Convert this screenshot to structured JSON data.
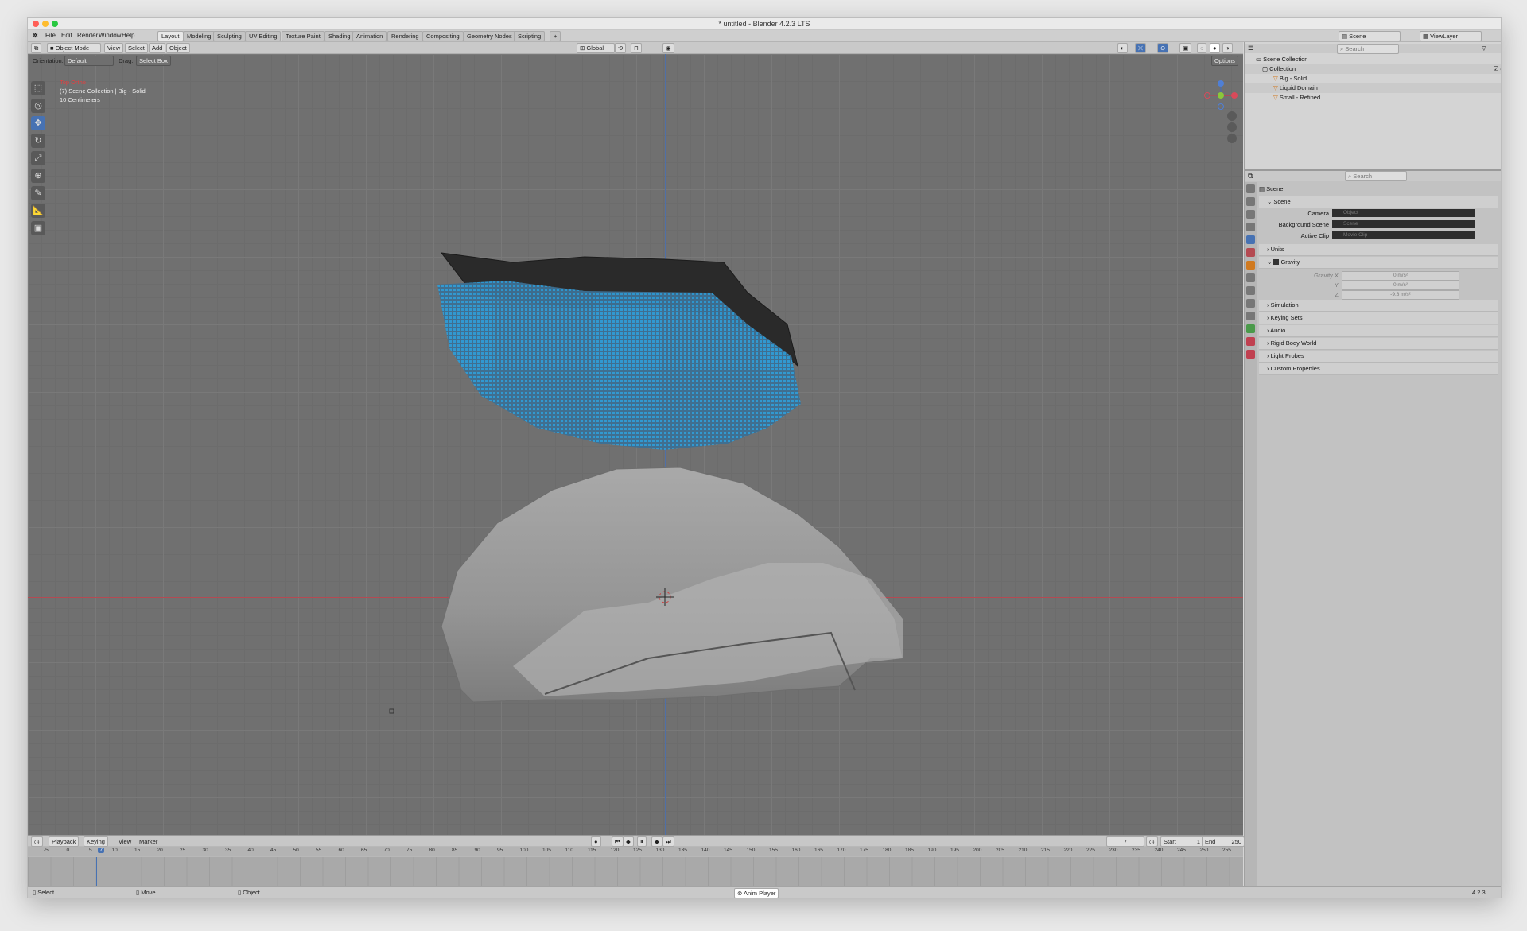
{
  "window": {
    "title": "* untitled - Blender 4.2.3 LTS"
  },
  "menubar": {
    "items": [
      "File",
      "Edit",
      "Render",
      "Window",
      "Help"
    ]
  },
  "workspaces": [
    "Layout",
    "Modeling",
    "Sculpting",
    "UV Editing",
    "Texture Paint",
    "Shading",
    "Animation",
    "Rendering",
    "Compositing",
    "Geometry Nodes",
    "Scripting"
  ],
  "top_right": {
    "scene": "Scene",
    "view_layer": "ViewLayer"
  },
  "viewport_header": {
    "mode": "Object Mode",
    "menus": [
      "View",
      "Select",
      "Add",
      "Object"
    ],
    "transform": "Global",
    "orientation_label": "Orientation:",
    "orientation_value": "Default",
    "drag_label": "Drag:",
    "drag_value": "Select Box",
    "options": "Options"
  },
  "viewport_info": {
    "line1": "Top Ortho",
    "line2": "(7) Scene Collection | Big - Solid",
    "line3": "10 Centimeters"
  },
  "outliner": {
    "root": "Scene Collection",
    "collection": "Collection",
    "objects": [
      "Big - Solid",
      "Liquid Domain",
      "Small - Refined"
    ]
  },
  "properties": {
    "search_placeholder": "Search",
    "scene_label": "Scene",
    "scene_panel": "Scene",
    "camera_label": "Camera",
    "camera_placeholder": "Object",
    "bg_scene_label": "Background Scene",
    "bg_scene_placeholder": "Scene",
    "active_clip_label": "Active Clip",
    "active_clip_placeholder": "Movie Clip",
    "units": "Units",
    "gravity": "Gravity",
    "gravity_x_label": "Gravity X",
    "gravity_x": "0 m/s²",
    "gravity_y_label": "Y",
    "gravity_y": "0 m/s²",
    "gravity_z_label": "Z",
    "gravity_z": "-9.8 m/s²",
    "sections": [
      "Simulation",
      "Keying Sets",
      "Audio",
      "Rigid Body World",
      "Light Probes",
      "Custom Properties"
    ]
  },
  "timeline": {
    "menus": [
      "Playback",
      "Keying",
      "View",
      "Marker"
    ],
    "current_frame": "7",
    "start_label": "Start",
    "start": "1",
    "end_label": "End",
    "end": "250",
    "ruler": [
      "-5",
      "0",
      "5",
      "7",
      "10",
      "15",
      "20",
      "25",
      "30",
      "35",
      "40",
      "45",
      "50",
      "55",
      "60",
      "65",
      "70",
      "75",
      "80",
      "85",
      "90",
      "95",
      "100",
      "105",
      "110",
      "115",
      "120",
      "125",
      "130",
      "135",
      "140",
      "145",
      "150",
      "155",
      "160",
      "165",
      "170",
      "175",
      "180",
      "185",
      "190",
      "195",
      "200",
      "205",
      "210",
      "215",
      "220",
      "225",
      "230",
      "235",
      "240",
      "245",
      "250",
      "255"
    ]
  },
  "statusbar": {
    "select": "Select",
    "move": "Move",
    "object": "Object",
    "anim_player": "Anim Player",
    "version": "4.2.3"
  },
  "colors": {
    "accent": "#4772b3",
    "voxel_blue": "#2e9bd6",
    "axis_red": "#b44a52",
    "axis_blue": "#4f6fa6"
  }
}
